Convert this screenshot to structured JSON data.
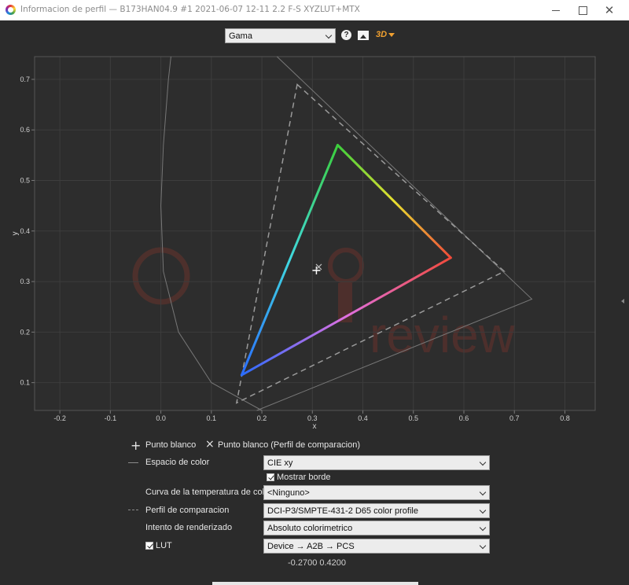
{
  "window": {
    "title": "Informacion de perfil — B173HAN04.9 #1 2021-06-07 12-11 2.2 F-S XYZLUT+MTX"
  },
  "toolbar": {
    "view_select": "Gama",
    "icons": [
      "help-icon",
      "save-image-icon",
      "3d-view-icon"
    ],
    "threed_label": "3D"
  },
  "chart_data": {
    "type": "scatter",
    "xlabel": "x",
    "ylabel": "y",
    "xlim": [
      -0.25,
      0.86
    ],
    "ylim": [
      0.045,
      0.745
    ],
    "x_ticks": [
      "-0.2",
      "-0.1",
      "0.0",
      "0.1",
      "0.2",
      "0.3",
      "0.4",
      "0.5",
      "0.6",
      "0.7",
      "0.8"
    ],
    "y_ticks": [
      "0.1",
      "0.2",
      "0.3",
      "0.4",
      "0.5",
      "0.6",
      "0.7"
    ],
    "grid": true,
    "series": [
      {
        "name": "Perfil",
        "style": "gradient-triangle",
        "points": [
          [
            0.35,
            0.57
          ],
          [
            0.574,
            0.347
          ],
          [
            0.16,
            0.115
          ]
        ]
      },
      {
        "name": "DCI-P3/SMPTE-431-2 D65 color profile",
        "style": "dashed",
        "points": [
          [
            0.27,
            0.69
          ],
          [
            0.68,
            0.32
          ],
          [
            0.15,
            0.06
          ]
        ]
      },
      {
        "name": "CIE xy",
        "style": "solid",
        "points": [
          [
            0.7347,
            0.2653
          ]
        ]
      }
    ],
    "white_point": [
      0.308,
      0.322
    ],
    "white_point_comparison": [
      0.3127,
      0.329
    ],
    "colors": {
      "red": "#f04a3a",
      "green": "#3ccf3c",
      "blue": "#2a6cff",
      "magenta": "#e070e0",
      "cyan": "#40d8e0",
      "yellow": "#e8e030"
    }
  },
  "legend": {
    "white_point": "Punto blanco",
    "white_point_comparison": "Punto blanco (Perfil de comparacion)"
  },
  "controls": {
    "color_space_label": "Espacio de color",
    "color_space_value": "CIE xy",
    "show_border_label": "Mostrar borde",
    "temperature_curve_label": "Curva de la temperatura de color",
    "temperature_curve_value": "<Ninguno>",
    "comparison_profile_label": "Perfil de comparacion",
    "comparison_profile_value": "DCI-P3/SMPTE-431-2 D65 color profile",
    "rendering_intent_label": "Intento de renderizado",
    "rendering_intent_value": "Absoluto colorimetrico",
    "lut_label": "LUT",
    "lut_value": "Device → A2B → PCS"
  },
  "status": {
    "coordinates": "-0.2700 0.4200"
  }
}
